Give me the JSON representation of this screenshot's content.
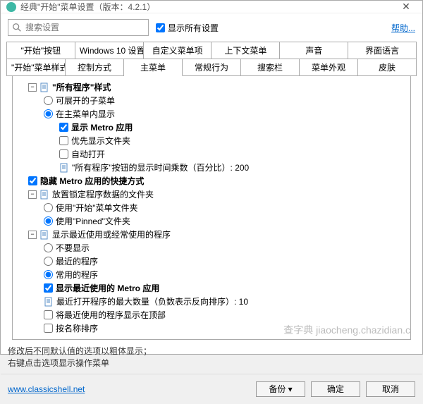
{
  "window": {
    "title": "经典\"开始\"菜单设置（版本：4.2.1）"
  },
  "search": {
    "placeholder": "搜索设置"
  },
  "show_all": {
    "label": "显示所有设置"
  },
  "help": {
    "label": "帮助..."
  },
  "tabs_row1": [
    "\"开始\"按钮",
    "Windows 10 设置",
    "自定义菜单项",
    "上下文菜单",
    "声音",
    "界面语言"
  ],
  "tabs_row2": [
    "\"开始\"菜单样式",
    "控制方式",
    "主菜单",
    "常规行为",
    "搜索栏",
    "菜单外观",
    "皮肤"
  ],
  "active_tab": "主菜单",
  "tree": [
    {
      "indent": 0,
      "type": "group",
      "label": "\"所有程序\"样式",
      "bold": true
    },
    {
      "indent": 1,
      "type": "radio",
      "checked": false,
      "label": "可展开的子菜单"
    },
    {
      "indent": 1,
      "type": "radio",
      "checked": true,
      "label": "在主菜单内显示"
    },
    {
      "indent": 2,
      "type": "check",
      "checked": true,
      "label": "显示 Metro 应用",
      "bold": true
    },
    {
      "indent": 2,
      "type": "check",
      "checked": false,
      "label": "优先显示文件夹"
    },
    {
      "indent": 2,
      "type": "check",
      "checked": false,
      "label": "自动打开"
    },
    {
      "indent": 2,
      "type": "doc",
      "label": "\"所有程序\"按钮的显示时间乘数（百分比）: 200"
    },
    {
      "indent": 0,
      "type": "check",
      "checked": true,
      "label": "隐藏 Metro 应用的快捷方式",
      "bold": true
    },
    {
      "indent": 0,
      "type": "group",
      "label": "放置锁定程序数据的文件夹"
    },
    {
      "indent": 1,
      "type": "radio",
      "checked": false,
      "label": "使用\"开始\"菜单文件夹"
    },
    {
      "indent": 1,
      "type": "radio",
      "checked": true,
      "label": "使用\"Pinned\"文件夹"
    },
    {
      "indent": 0,
      "type": "group",
      "label": "显示最近使用或经常使用的程序"
    },
    {
      "indent": 1,
      "type": "radio",
      "checked": false,
      "label": "不要显示"
    },
    {
      "indent": 1,
      "type": "radio",
      "checked": false,
      "label": "最近的程序"
    },
    {
      "indent": 1,
      "type": "radio",
      "checked": true,
      "label": "常用的程序"
    },
    {
      "indent": 1,
      "type": "check",
      "checked": true,
      "label": "显示最近使用的 Metro 应用",
      "bold": true
    },
    {
      "indent": 1,
      "type": "doc",
      "label": "最近打开程序的最大数量（负数表示反向排序）: 10"
    },
    {
      "indent": 1,
      "type": "check",
      "checked": false,
      "label": "将最近使用的程序显示在顶部"
    },
    {
      "indent": 1,
      "type": "check",
      "checked": false,
      "label": "按名称排序"
    }
  ],
  "footer_note": {
    "line1": "修改后不同默认值的选项以粗体显示；",
    "line2": "右键点击选项显示操作菜单"
  },
  "buttons": {
    "backup": "备份",
    "ok": "确定",
    "cancel": "取消"
  },
  "link": {
    "url": "www.classicshell.net"
  },
  "watermark": "查字典 jiaocheng.chazidian.c"
}
